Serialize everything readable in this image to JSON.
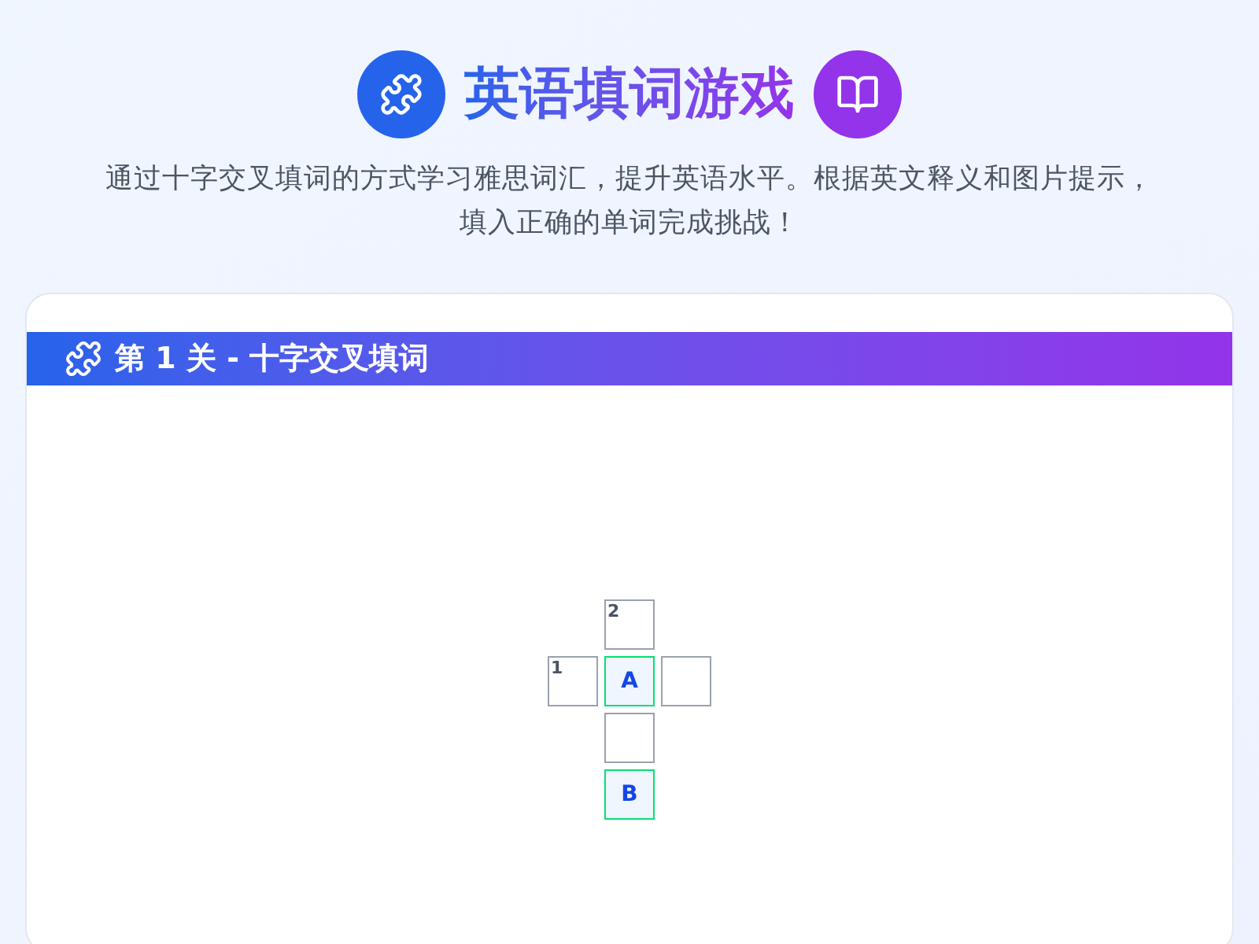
{
  "header": {
    "title": "英语填词游戏",
    "description": "通过十字交叉填词的方式学习雅思词汇，提升英语水平。根据英文释义和图片提示，填入正确的单词完成挑战！"
  },
  "level": {
    "title": "第 1 关 - 十字交叉填词"
  },
  "grid": {
    "rows": [
      {
        "cells": [
          {
            "kind": "blank"
          },
          {
            "kind": "box",
            "number": "2",
            "revealed": false
          },
          {
            "kind": "blank"
          }
        ]
      },
      {
        "cells": [
          {
            "kind": "box",
            "number": "1",
            "revealed": false
          },
          {
            "kind": "box",
            "letter": "A",
            "revealed": true
          },
          {
            "kind": "box",
            "revealed": false
          }
        ]
      },
      {
        "cells": [
          {
            "kind": "blank"
          },
          {
            "kind": "box",
            "revealed": false
          },
          {
            "kind": "blank"
          }
        ]
      },
      {
        "cells": [
          {
            "kind": "blank"
          },
          {
            "kind": "box",
            "letter": "B",
            "revealed": true
          },
          {
            "kind": "blank"
          }
        ]
      }
    ]
  }
}
